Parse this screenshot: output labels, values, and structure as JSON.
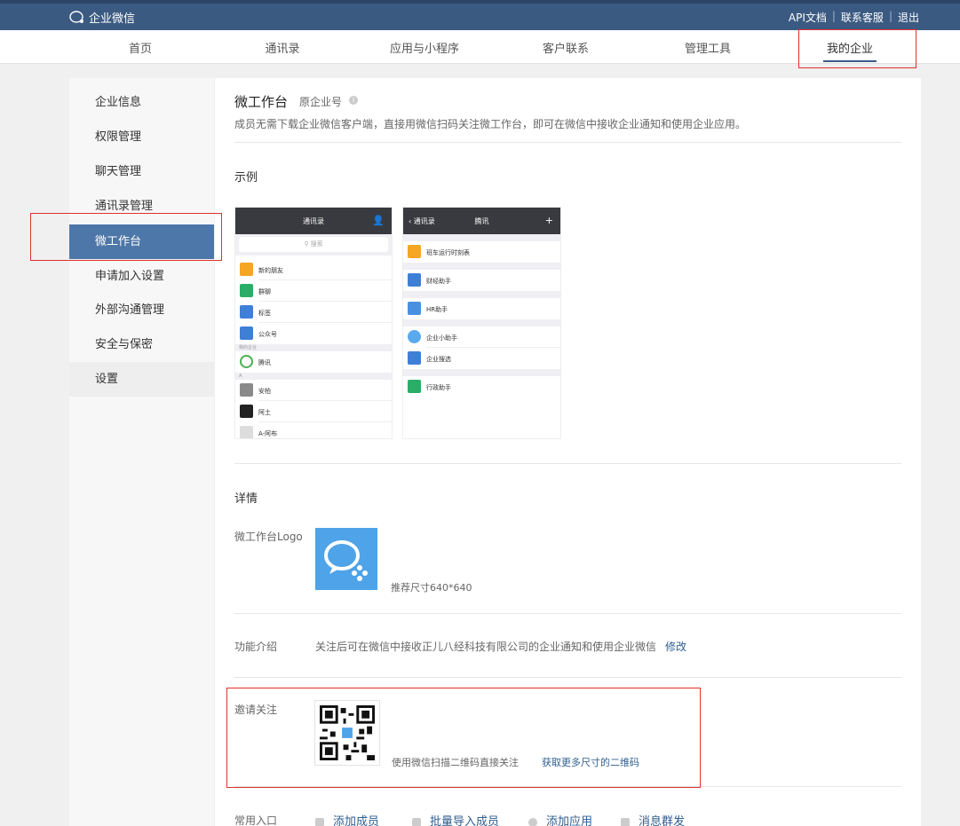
{
  "app": {
    "brand": "企业微信"
  },
  "top_links": [
    "API文档",
    "联系客服",
    "退出"
  ],
  "nav_tabs": [
    "首页",
    "通讯录",
    "应用与小程序",
    "客户联系",
    "管理工具",
    "我的企业"
  ],
  "sidebar": {
    "items": [
      "企业信息",
      "权限管理",
      "聊天管理",
      "通讯录管理",
      "微工作台",
      "申请加入设置",
      "外部沟通管理",
      "安全与保密",
      "设置"
    ],
    "active": "微工作台"
  },
  "page": {
    "title": "微工作台",
    "subtitle": "原企业号",
    "description": "成员无需下载企业微信客户端，直接用微信扫码关注微工作台，即可在微信中接收企业通知和使用企业应用。",
    "example_heading": "示例",
    "details_heading": "详情"
  },
  "phone1": {
    "title": "通讯录",
    "search_placeholder": "搜索",
    "rows": [
      "新的朋友",
      "群聊",
      "标签",
      "公众号",
      "腾讯",
      "安柏",
      "阿土",
      "A-阿布"
    ],
    "section_label": "我的企业",
    "letter": "A"
  },
  "phone2": {
    "back": "通讯录",
    "title": "腾讯",
    "rows": [
      "班车运行时刻表",
      "财经助手",
      "HR助手",
      "企业小助手",
      "企业搜选",
      "行政助手"
    ]
  },
  "details": {
    "logo_label": "微工作台Logo",
    "logo_size": "推荐尺寸640*640",
    "intro_label": "功能介绍",
    "intro_text": "关注后可在微信中接收正儿八经科技有限公司的企业通知和使用企业微信",
    "modify": "修改",
    "invite_label": "邀请关注",
    "qr_hint": "使用微信扫描二维码直接关注",
    "qr_more": "获取更多尺寸的二维码"
  },
  "entries": {
    "label": "常用入口",
    "items": [
      "添加成员",
      "批量导入成员",
      "添加应用",
      "消息群发"
    ]
  },
  "colors": {
    "topbar": "#3b5a82",
    "active_side": "#4d77a8",
    "highlight": "#e0312b",
    "link": "#2f5e8f",
    "logo_bg": "#4fa3e8"
  }
}
